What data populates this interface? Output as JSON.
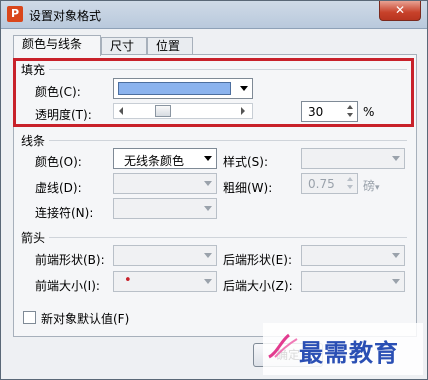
{
  "window": {
    "title": "设置对象格式",
    "app_icon_letter": "P",
    "close_label": "✕"
  },
  "tabs": [
    {
      "label": "颜色与线条",
      "active": true
    },
    {
      "label": "尺寸",
      "active": false
    },
    {
      "label": "位置",
      "active": false
    }
  ],
  "fill": {
    "group_label": "填充",
    "color_label": "颜色(C):",
    "color_value": "#8bb3ee",
    "transparency_label": "透明度(T):",
    "transparency_value": "30",
    "transparency_unit": "%",
    "transparency_fraction": 0.3
  },
  "line": {
    "group_label": "线条",
    "color_label": "颜色(O):",
    "color_value": "无线条颜色",
    "style_label": "样式(S):",
    "dash_label": "虚线(D):",
    "weight_label": "粗细(W):",
    "weight_value": "0.75",
    "weight_unit": "磅",
    "connector_label": "连接符(N):"
  },
  "arrows": {
    "group_label": "箭头",
    "begin_style_label": "前端形状(B):",
    "end_style_label": "后端形状(E):",
    "begin_size_label": "前端大小(I):",
    "end_size_label": "后端大小(Z):",
    "begin_size_marker": "•"
  },
  "default_checkbox_label": "新对象默认值(F)",
  "ok_label": "确定",
  "watermark_text": "最需教育"
}
